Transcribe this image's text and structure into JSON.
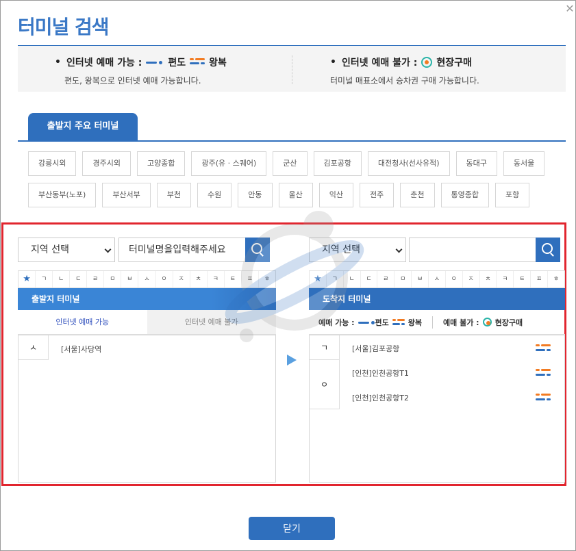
{
  "dialog": {
    "title": "터미널 검색",
    "close_glyph": "✕"
  },
  "info": {
    "left_head": "인터넷 예매 가능 :",
    "one_way": "편도",
    "round_trip": "왕복",
    "left_sub": "편도, 왕복으로 인터넷 예매 가능합니다.",
    "right_head": "인터넷 예매 불가 :",
    "onsite": "현장구매",
    "right_sub": "터미널 매표소에서 승차권 구매 가능합니다.",
    "bullet": "•"
  },
  "main_tab": {
    "label": "출발지 주요 터미널"
  },
  "chips_row1": [
    "강릉시외",
    "경주시외",
    "고양종합",
    "광주(유 · 스퀘어)",
    "군산",
    "김포공항",
    "대전청사(선사유적)",
    "동대구",
    "동서울"
  ],
  "chips_row2": [
    "부산동부(노포)",
    "부산서부",
    "부천",
    "수원",
    "안동",
    "울산",
    "익산",
    "전주",
    "춘천",
    "통영종합",
    "포항"
  ],
  "left": {
    "region_select": "지역 선택",
    "search_value": "터미널명을입력해주세요",
    "header": "출발지 터미널",
    "subtab_on": "인터넷 예매 가능",
    "subtab_off": "인터넷 예매 불가",
    "groups": [
      {
        "letter": "ㅅ",
        "items": [
          "[서울]사당역"
        ]
      }
    ]
  },
  "right": {
    "region_select": "지역 선택",
    "search_value": "",
    "header": "도착지 터미널",
    "legend_label_ok": "예매 가능 :",
    "legend_one_way": "편도",
    "legend_round": "왕복",
    "legend_label_no": "예매 불가 :",
    "legend_onsite": "현장구매",
    "groups": [
      {
        "letter": "ㄱ",
        "items": [
          "[서울]김포공항"
        ]
      },
      {
        "letter": "ㅇ",
        "items": [
          "[인천]인천공항T1",
          "[인천]인천공항T2"
        ]
      }
    ]
  },
  "consonants": [
    "★",
    "ㄱ",
    "ㄴ",
    "ㄷ",
    "ㄹ",
    "ㅁ",
    "ㅂ",
    "ㅅ",
    "ㅇ",
    "ㅈ",
    "ㅊ",
    "ㅋ",
    "ㅌ",
    "ㅍ",
    "ㅎ"
  ],
  "footer": {
    "close_label": "닫기"
  },
  "colors": {
    "primary": "#2f6fbd",
    "highlight": "#e1252e",
    "orange": "#f27b22",
    "teal": "#2ab4a8"
  }
}
